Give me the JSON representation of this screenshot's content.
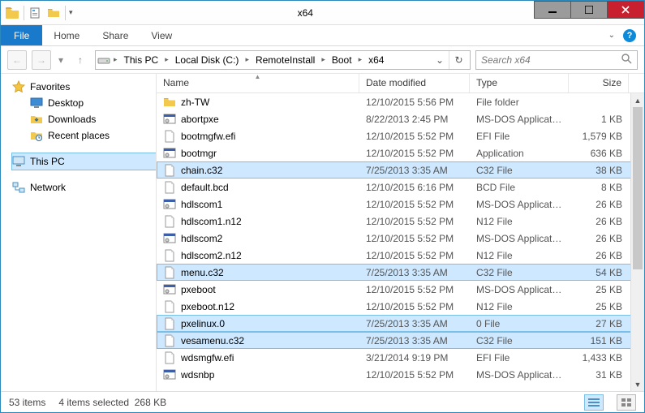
{
  "title": "x64",
  "ribbon": {
    "file": "File",
    "tabs": [
      "Home",
      "Share",
      "View"
    ]
  },
  "nav": {
    "crumbs": [
      "This PC",
      "Local Disk (C:)",
      "RemoteInstall",
      "Boot",
      "x64"
    ],
    "search_placeholder": "Search x64"
  },
  "sidebar": {
    "favorites": {
      "label": "Favorites",
      "items": [
        "Desktop",
        "Downloads",
        "Recent places"
      ]
    },
    "thispc": "This PC",
    "network": "Network"
  },
  "columns": {
    "name": "Name",
    "date": "Date modified",
    "type": "Type",
    "size": "Size"
  },
  "rows": [
    {
      "icon": "folder",
      "name": "zh-TW",
      "date": "12/10/2015 5:56 PM",
      "type": "File folder",
      "size": "",
      "sel": false
    },
    {
      "icon": "app",
      "name": "abortpxe",
      "date": "8/22/2013 2:45 PM",
      "type": "MS-DOS Applicati...",
      "size": "1 KB",
      "sel": false
    },
    {
      "icon": "file",
      "name": "bootmgfw.efi",
      "date": "12/10/2015 5:52 PM",
      "type": "EFI File",
      "size": "1,579 KB",
      "sel": false
    },
    {
      "icon": "app",
      "name": "bootmgr",
      "date": "12/10/2015 5:52 PM",
      "type": "Application",
      "size": "636 KB",
      "sel": false
    },
    {
      "icon": "file",
      "name": "chain.c32",
      "date": "7/25/2013 3:35 AM",
      "type": "C32 File",
      "size": "38 KB",
      "sel": true
    },
    {
      "icon": "file",
      "name": "default.bcd",
      "date": "12/10/2015 6:16 PM",
      "type": "BCD File",
      "size": "8 KB",
      "sel": false
    },
    {
      "icon": "app",
      "name": "hdlscom1",
      "date": "12/10/2015 5:52 PM",
      "type": "MS-DOS Applicati...",
      "size": "26 KB",
      "sel": false
    },
    {
      "icon": "file",
      "name": "hdlscom1.n12",
      "date": "12/10/2015 5:52 PM",
      "type": "N12 File",
      "size": "26 KB",
      "sel": false
    },
    {
      "icon": "app",
      "name": "hdlscom2",
      "date": "12/10/2015 5:52 PM",
      "type": "MS-DOS Applicati...",
      "size": "26 KB",
      "sel": false
    },
    {
      "icon": "file",
      "name": "hdlscom2.n12",
      "date": "12/10/2015 5:52 PM",
      "type": "N12 File",
      "size": "26 KB",
      "sel": false
    },
    {
      "icon": "file",
      "name": "menu.c32",
      "date": "7/25/2013 3:35 AM",
      "type": "C32 File",
      "size": "54 KB",
      "sel": true
    },
    {
      "icon": "app",
      "name": "pxeboot",
      "date": "12/10/2015 5:52 PM",
      "type": "MS-DOS Applicati...",
      "size": "25 KB",
      "sel": false
    },
    {
      "icon": "file",
      "name": "pxeboot.n12",
      "date": "12/10/2015 5:52 PM",
      "type": "N12 File",
      "size": "25 KB",
      "sel": false
    },
    {
      "icon": "file",
      "name": "pxelinux.0",
      "date": "7/25/2013 3:35 AM",
      "type": "0 File",
      "size": "27 KB",
      "sel": true
    },
    {
      "icon": "file",
      "name": "vesamenu.c32",
      "date": "7/25/2013 3:35 AM",
      "type": "C32 File",
      "size": "151 KB",
      "sel": true
    },
    {
      "icon": "file",
      "name": "wdsmgfw.efi",
      "date": "3/21/2014 9:19 PM",
      "type": "EFI File",
      "size": "1,433 KB",
      "sel": false
    },
    {
      "icon": "app",
      "name": "wdsnbp",
      "date": "12/10/2015 5:52 PM",
      "type": "MS-DOS Applicati...",
      "size": "31 KB",
      "sel": false
    }
  ],
  "status": {
    "items": "53 items",
    "selected": "4 items selected",
    "size": "268 KB"
  }
}
